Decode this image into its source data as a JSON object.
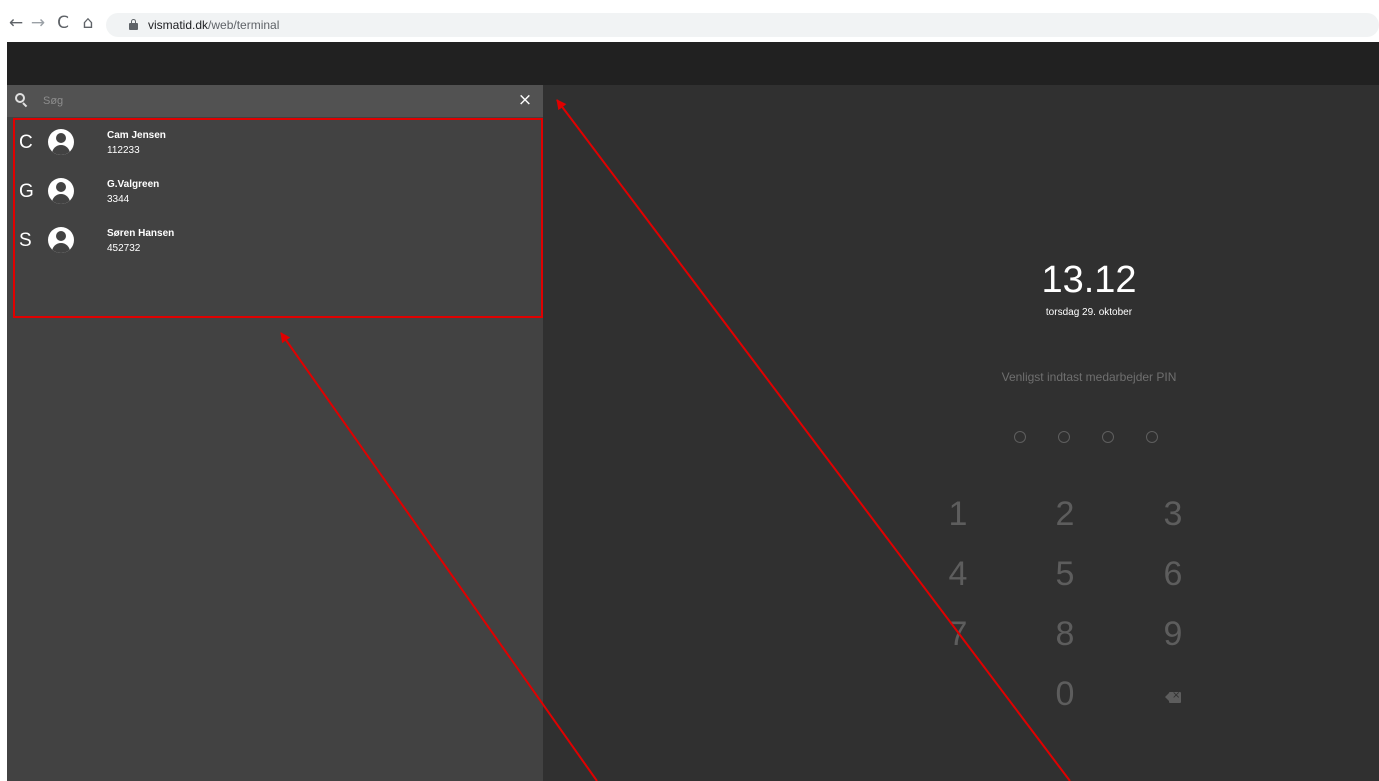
{
  "browser": {
    "nav_back": "←",
    "nav_forward": "→",
    "nav_reload": "C",
    "nav_home": "⌂",
    "url_host": "vismatid.dk",
    "url_path": "/web/terminal"
  },
  "search": {
    "placeholder": "Søg",
    "close_glyph": "×"
  },
  "employees": [
    {
      "letter": "C",
      "name": "Cam Jensen",
      "number": "112233"
    },
    {
      "letter": "G",
      "name": "G.Valgreen",
      "number": "3344"
    },
    {
      "letter": "S",
      "name": "Søren Hansen",
      "number": "452732"
    }
  ],
  "clock": {
    "time": "13.12",
    "date": "torsdag 29. oktober"
  },
  "pin": {
    "prompt": "Venligst indtast medarbejder PIN",
    "dot_count": 4
  },
  "keypad": {
    "keys": [
      "1",
      "2",
      "3",
      "4",
      "5",
      "6",
      "7",
      "8",
      "9",
      "0"
    ],
    "backspace_icon": "backspace-icon"
  },
  "colors": {
    "annotation": "#e00000",
    "header": "#212121",
    "left_panel": "#424242",
    "right_panel": "#303030"
  }
}
